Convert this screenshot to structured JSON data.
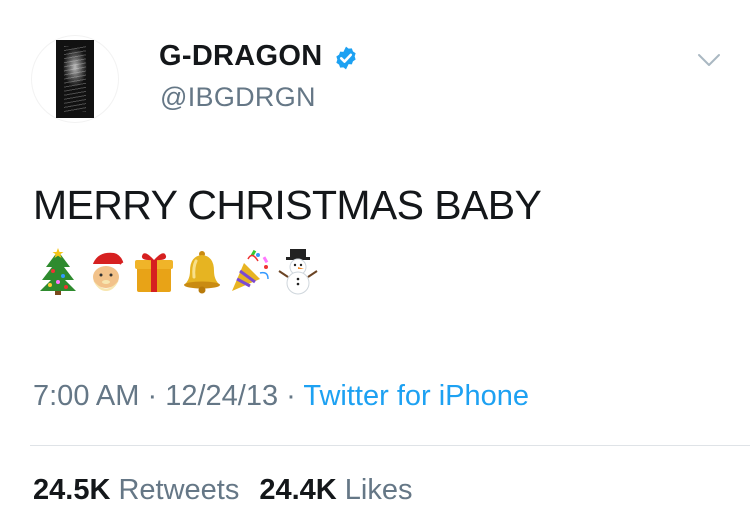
{
  "tweet": {
    "author": {
      "display_name": "G-DRAGON",
      "handle": "@IBGDRGN",
      "verified": true
    },
    "text": "MERRY CHRISTMAS BABY",
    "emojis": [
      "christmas-tree",
      "santa-claus",
      "wrapped-gift",
      "bell",
      "party-popper",
      "snowman"
    ],
    "time": "7:00 AM",
    "separator": "·",
    "date": "12/24/13",
    "source": "Twitter for iPhone",
    "stats": {
      "retweets_count": "24.5K",
      "retweets_label": "Retweets",
      "likes_count": "24.4K",
      "likes_label": "Likes"
    }
  },
  "colors": {
    "text": "#14171a",
    "secondary": "#657786",
    "link": "#1da1f2",
    "verified": "#1da1f2",
    "divider": "#dfe3e7"
  }
}
